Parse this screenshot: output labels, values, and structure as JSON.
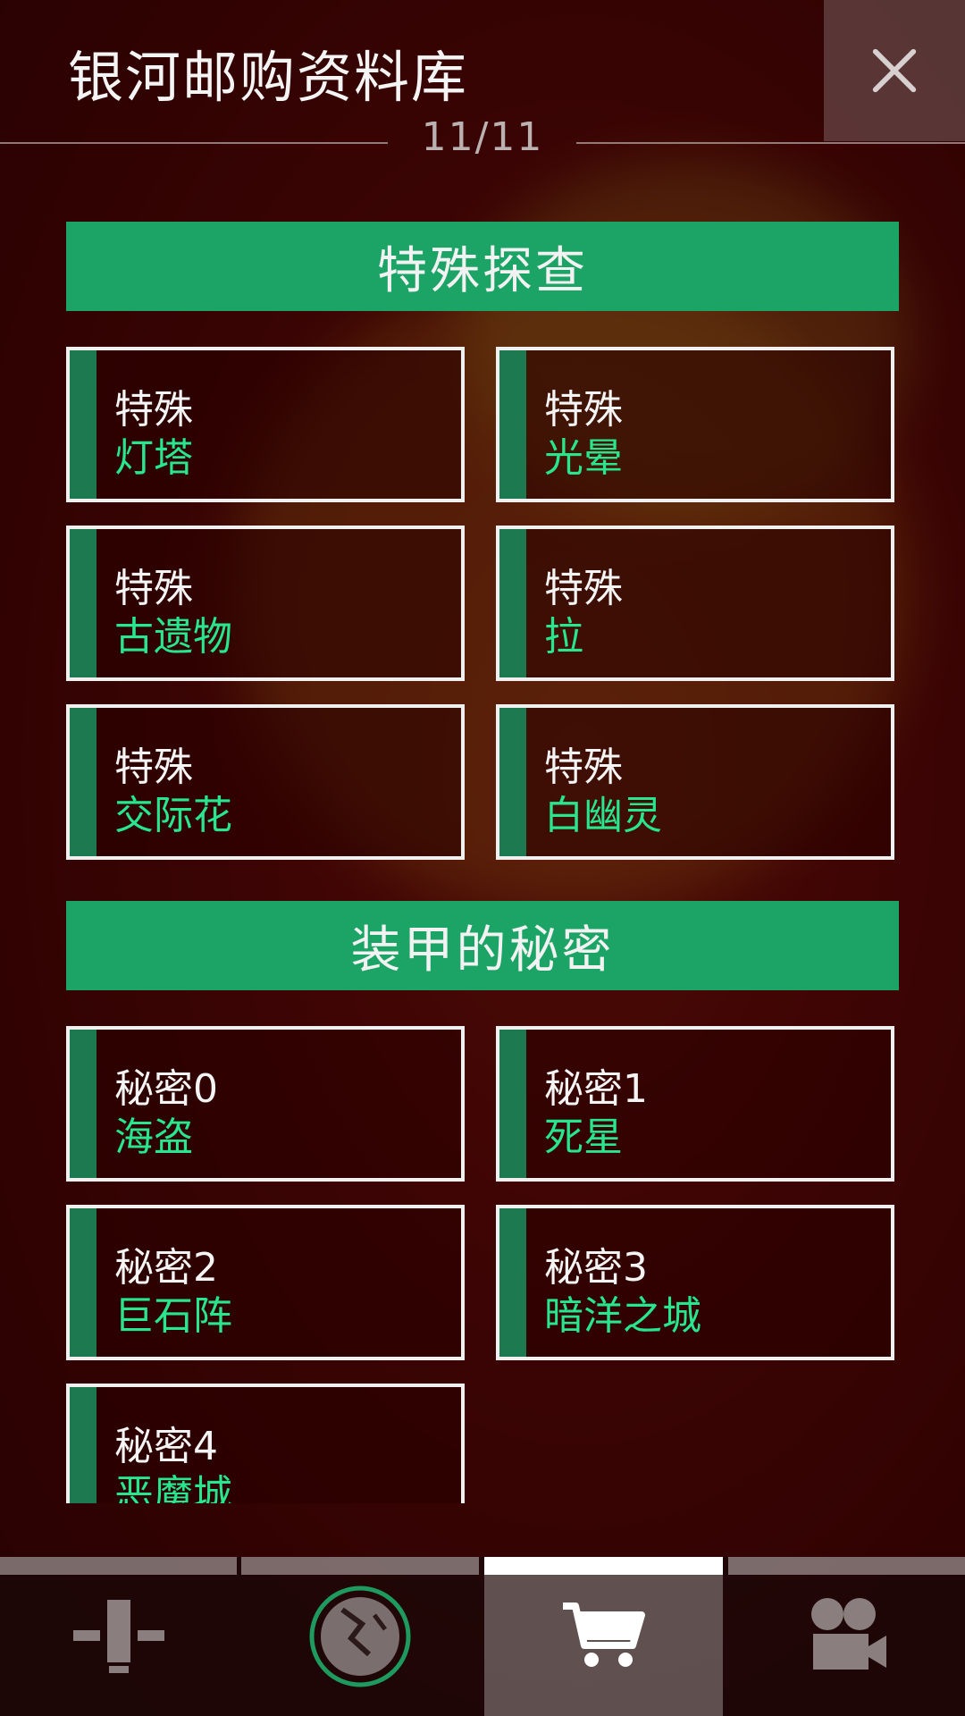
{
  "header": {
    "title": "银河邮购资料库",
    "page_count": "11/11",
    "close_icon": "close-icon"
  },
  "sections": [
    {
      "title": "特殊探查",
      "cards": [
        {
          "line1": "特殊",
          "line2": "灯塔"
        },
        {
          "line1": "特殊",
          "line2": "光晕"
        },
        {
          "line1": "特殊",
          "line2": "古遗物"
        },
        {
          "line1": "特殊",
          "line2": "拉"
        },
        {
          "line1": "特殊",
          "line2": "交际花"
        },
        {
          "line1": "特殊",
          "line2": "白幽灵"
        }
      ]
    },
    {
      "title": "装甲的秘密",
      "cards": [
        {
          "line1": "秘密0",
          "line2": "海盗"
        },
        {
          "line1": "秘密1",
          "line2": "死星"
        },
        {
          "line1": "秘密2",
          "line2": "巨石阵"
        },
        {
          "line1": "秘密3",
          "line2": "暗洋之城"
        },
        {
          "line1": "秘密4",
          "line2": "恶魔城"
        }
      ]
    }
  ],
  "tabs": [
    {
      "icon": "antenna-icon",
      "active": false
    },
    {
      "icon": "planet-icon",
      "active": false
    },
    {
      "icon": "shopping-cart-icon",
      "active": true
    },
    {
      "icon": "camera-icon",
      "active": false
    }
  ],
  "colors": {
    "accent_green": "#1ba466",
    "text_green": "#27e68d",
    "card_stripe": "#1d7a50",
    "background": "#5a0c0a"
  }
}
